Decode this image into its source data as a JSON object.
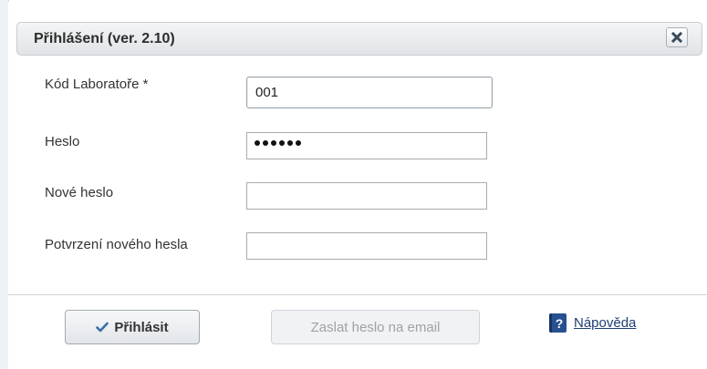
{
  "dialog": {
    "title": "Přihlášení (ver. 2.10)",
    "close_icon": "close-icon"
  },
  "form": {
    "lab_code": {
      "label": "Kód Laboratoře *",
      "value": "001"
    },
    "password": {
      "label": "Heslo",
      "masked_length": 6
    },
    "new_password": {
      "label": "Nové heslo",
      "value": ""
    },
    "confirm_password": {
      "label": "Potvrzení nového hesla",
      "value": ""
    }
  },
  "actions": {
    "login_label": "Přihlásit",
    "login_icon": "checkmark-icon",
    "send_password_label": "Zaslat heslo na email",
    "help_label": "Nápověda",
    "help_icon": "help-book-icon"
  },
  "colors": {
    "titlebar": "#e1e3e6",
    "link": "#1f3f75",
    "help_icon": "#27508f",
    "disabled_text": "#9ea3a8"
  }
}
